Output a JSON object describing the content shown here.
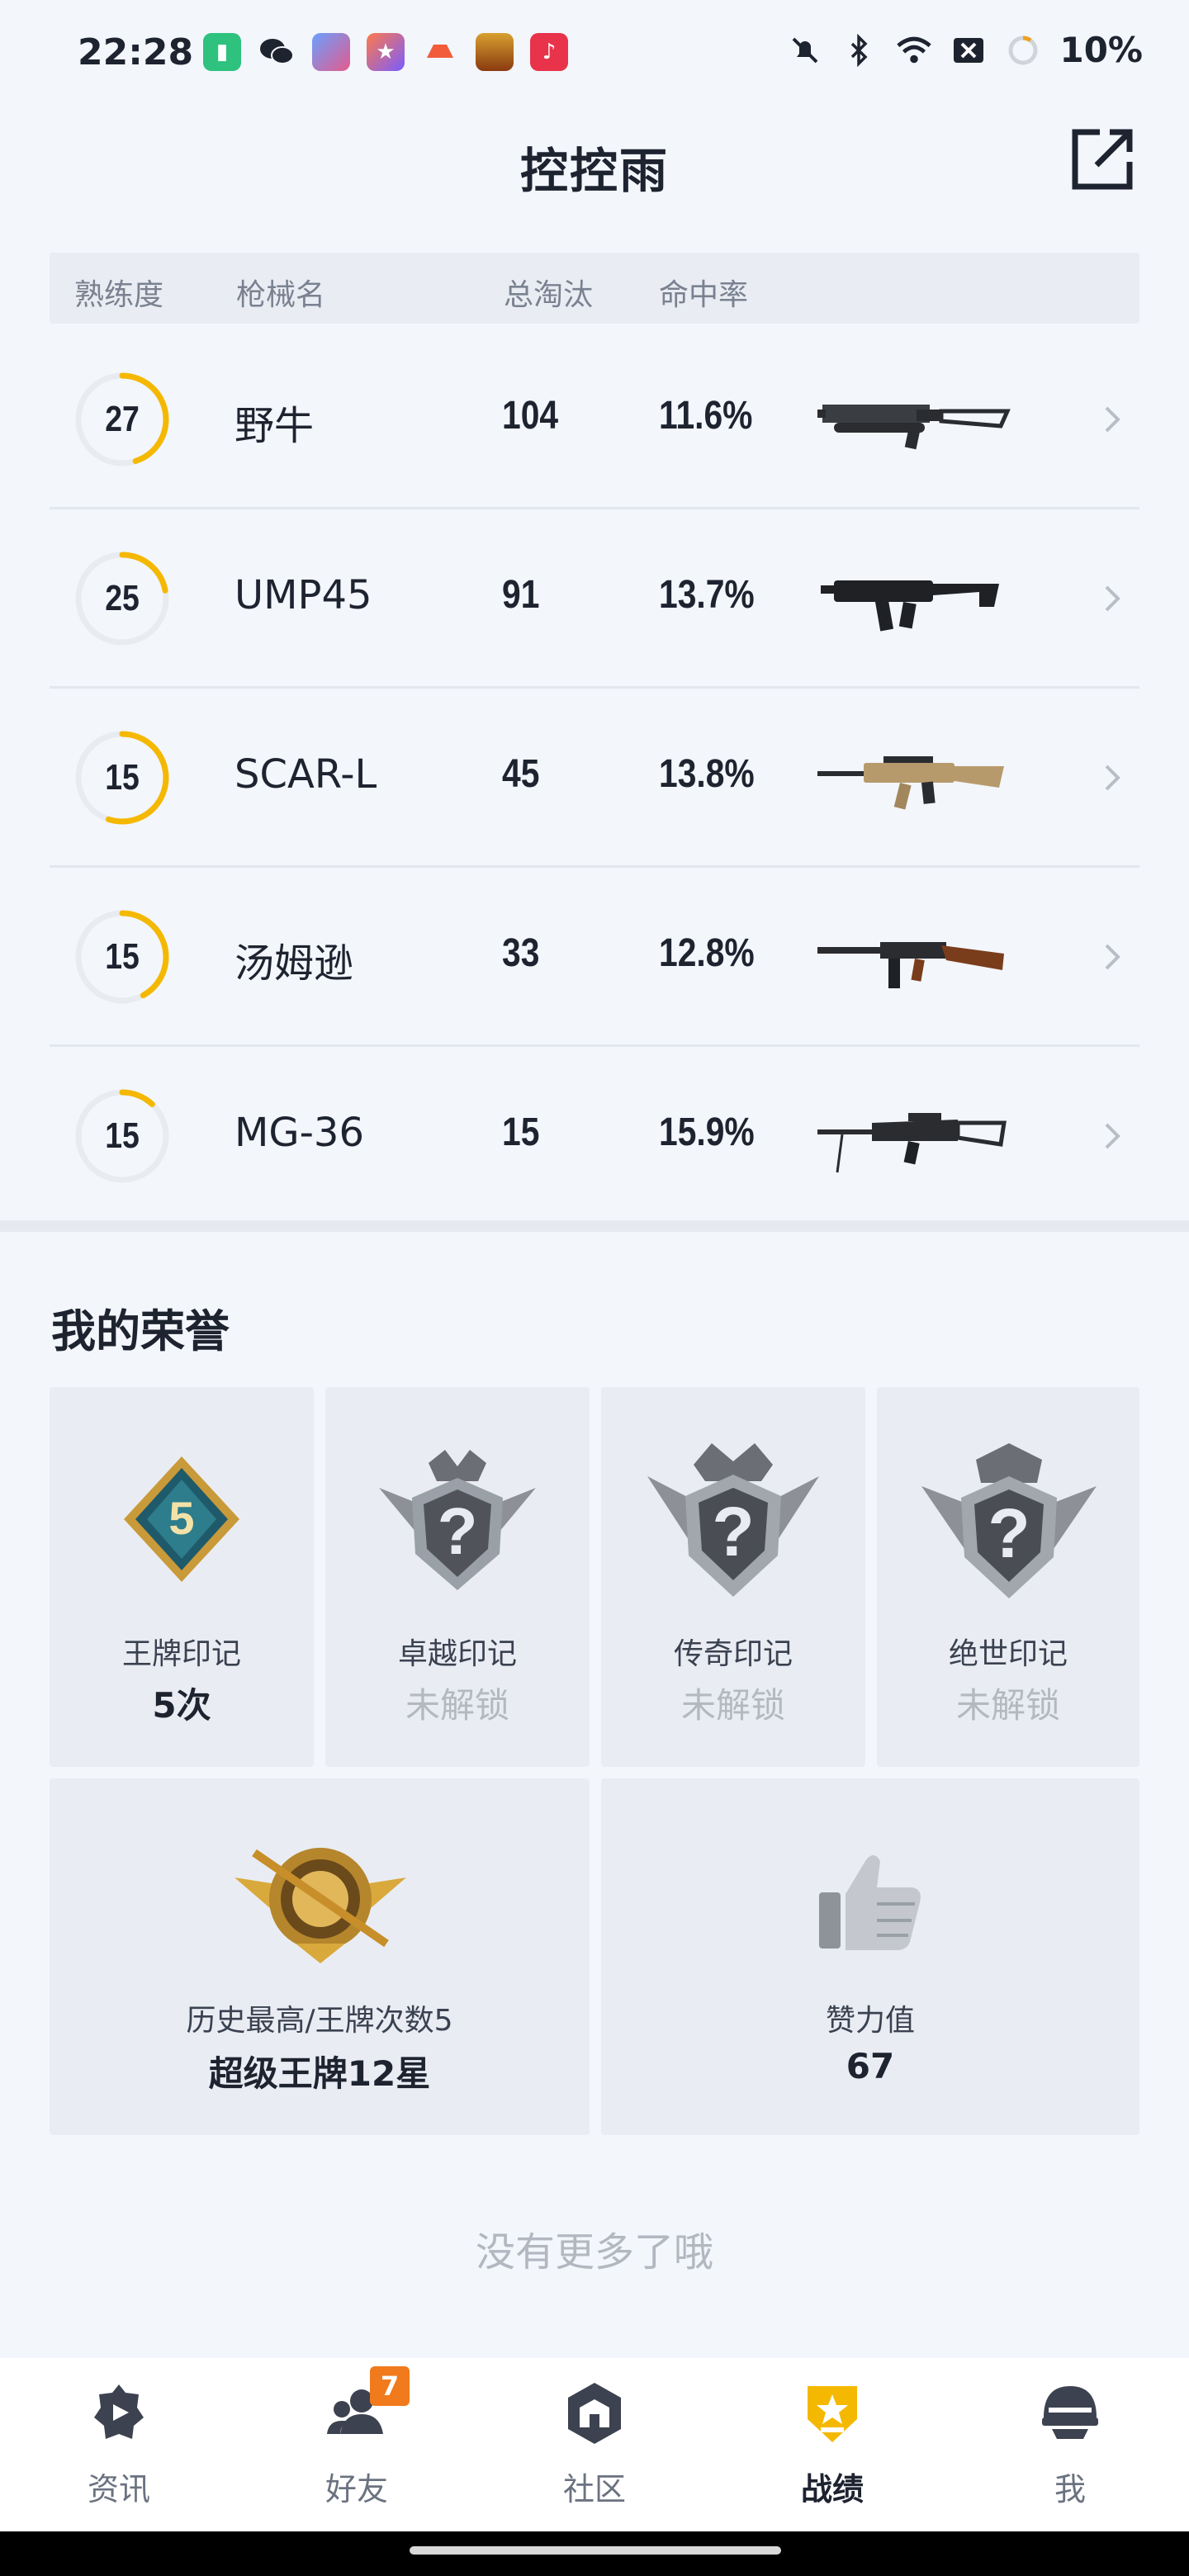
{
  "status_bar": {
    "time": "22:28",
    "battery": "10%",
    "app_icons": [
      "battery-saver-icon",
      "wechat-icon",
      "game-icon",
      "star-app-icon",
      "game-controller-icon",
      "peace-elite-icon",
      "music-icon"
    ],
    "system_icons": [
      "mute-bell-icon",
      "bluetooth-icon",
      "wifi-icon",
      "x-box-icon",
      "battery-ring-icon"
    ]
  },
  "header": {
    "title": "控控雨"
  },
  "table": {
    "columns": {
      "mastery": "熟练度",
      "weapon": "枪械名",
      "kills": "总淘汰",
      "accuracy": "命中率"
    },
    "rows": [
      {
        "level": "27",
        "progress": 0.45,
        "name": "野牛",
        "kills": "104",
        "accuracy": "11.6%",
        "gun_icon": "bizon-gun-icon"
      },
      {
        "level": "25",
        "progress": 0.22,
        "name": "UMP45",
        "kills": "91",
        "accuracy": "13.7%",
        "gun_icon": "ump45-gun-icon"
      },
      {
        "level": "15",
        "progress": 0.55,
        "name": "SCAR-L",
        "kills": "45",
        "accuracy": "13.8%",
        "gun_icon": "scar-l-gun-icon"
      },
      {
        "level": "15",
        "progress": 0.42,
        "name": "汤姆逊",
        "kills": "33",
        "accuracy": "12.8%",
        "gun_icon": "thompson-gun-icon"
      },
      {
        "level": "15",
        "progress": 0.12,
        "name": "MG-36",
        "kills": "15",
        "accuracy": "15.9%",
        "gun_icon": "mg36-gun-icon"
      }
    ]
  },
  "honors": {
    "title": "我的荣誉",
    "marks": [
      {
        "label": "王牌印记",
        "value": "5次",
        "locked": false,
        "badge_number": "5"
      },
      {
        "label": "卓越印记",
        "value": "未解锁",
        "locked": true
      },
      {
        "label": "传奇印记",
        "value": "未解锁",
        "locked": true
      },
      {
        "label": "绝世印记",
        "value": "未解锁",
        "locked": true
      }
    ],
    "highest": {
      "label": "历史最高/王牌次数5",
      "value": "超级王牌12星"
    },
    "likes": {
      "label": "赞力值",
      "value": "67"
    }
  },
  "footer_text": "没有更多了哦",
  "tabs": [
    {
      "label": "资讯",
      "icon": "news-icon",
      "active": false
    },
    {
      "label": "好友",
      "icon": "friends-icon",
      "active": false,
      "badge": "7"
    },
    {
      "label": "社区",
      "icon": "community-icon",
      "active": false
    },
    {
      "label": "战绩",
      "icon": "record-icon",
      "active": true
    },
    {
      "label": "我",
      "icon": "helmet-icon",
      "active": false
    }
  ],
  "colors": {
    "accent": "#f5b800",
    "ring_track": "#e8ebf0",
    "badge_orange": "#f07a1c"
  }
}
